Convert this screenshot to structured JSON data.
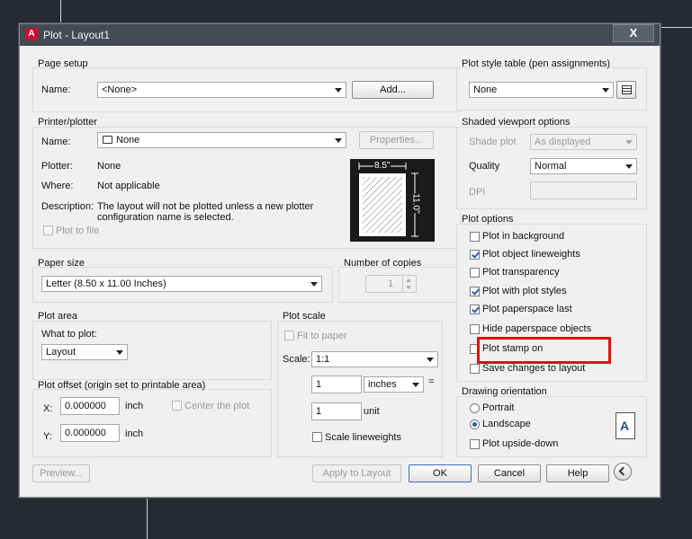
{
  "title": "Plot - Layout1",
  "close_label": "X",
  "page_setup": {
    "group_label": "Page setup",
    "name_label": "Name:",
    "name_value": "<None>",
    "add_label": "Add..."
  },
  "printer": {
    "group_label": "Printer/plotter",
    "name_label": "Name:",
    "name_value": "None",
    "properties_label": "Properties...",
    "plotter_label": "Plotter:",
    "plotter_value": "None",
    "where_label": "Where:",
    "where_value": "Not applicable",
    "description_label": "Description:",
    "description_line1": "The layout will not be plotted unless a new plotter",
    "description_line2": "configuration name is selected.",
    "plot_to_file_label": "Plot to file",
    "preview_width": "8.5\"",
    "preview_height": "11.0\""
  },
  "paper_size": {
    "group_label": "Paper size",
    "value": "Letter (8.50 x 11.00 Inches)"
  },
  "copies": {
    "group_label": "Number of copies",
    "value": "1"
  },
  "plot_area": {
    "group_label": "Plot area",
    "what_label": "What to plot:",
    "value": "Layout"
  },
  "plot_offset": {
    "group_label": "Plot offset (origin set to printable area)",
    "x_label": "X:",
    "x_value": "0.000000",
    "y_label": "Y:",
    "y_value": "0.000000",
    "unit": "inch",
    "center_label": "Center the plot"
  },
  "plot_scale": {
    "group_label": "Plot scale",
    "fit_label": "Fit to paper",
    "scale_label": "Scale:",
    "scale_value": "1:1",
    "value1": "1",
    "units": "inches",
    "equals": "=",
    "value2": "1",
    "unit_label": "unit",
    "lineweights_label": "Scale lineweights"
  },
  "plot_style": {
    "group_label": "Plot style table (pen assignments)",
    "value": "None"
  },
  "shaded": {
    "group_label": "Shaded viewport options",
    "shade_label": "Shade plot",
    "shade_value": "As displayed",
    "quality_label": "Quality",
    "quality_value": "Normal",
    "dpi_label": "DPI"
  },
  "plot_options": {
    "group_label": "Plot options",
    "items": [
      {
        "label": "Plot in background",
        "checked": false
      },
      {
        "label": "Plot object lineweights",
        "checked": true
      },
      {
        "label": "Plot transparency",
        "checked": false
      },
      {
        "label": "Plot with plot styles",
        "checked": true
      },
      {
        "label": "Plot paperspace last",
        "checked": true
      },
      {
        "label": "Hide paperspace objects",
        "checked": false
      },
      {
        "label": "Plot stamp on",
        "checked": false
      },
      {
        "label": "Save changes to layout",
        "checked": false
      }
    ]
  },
  "orientation": {
    "group_label": "Drawing orientation",
    "portrait_label": "Portrait",
    "landscape_label": "Landscape",
    "upside_down_label": "Plot upside-down",
    "selected": "Landscape",
    "icon_letter": "A"
  },
  "buttons": {
    "preview": "Preview...",
    "apply": "Apply to Layout",
    "ok": "OK",
    "cancel": "Cancel",
    "help": "Help"
  },
  "colors": {
    "background": "#262b33",
    "titlebar": "#454b54",
    "highlight": "#e01010",
    "check": "#2a5fb0"
  }
}
